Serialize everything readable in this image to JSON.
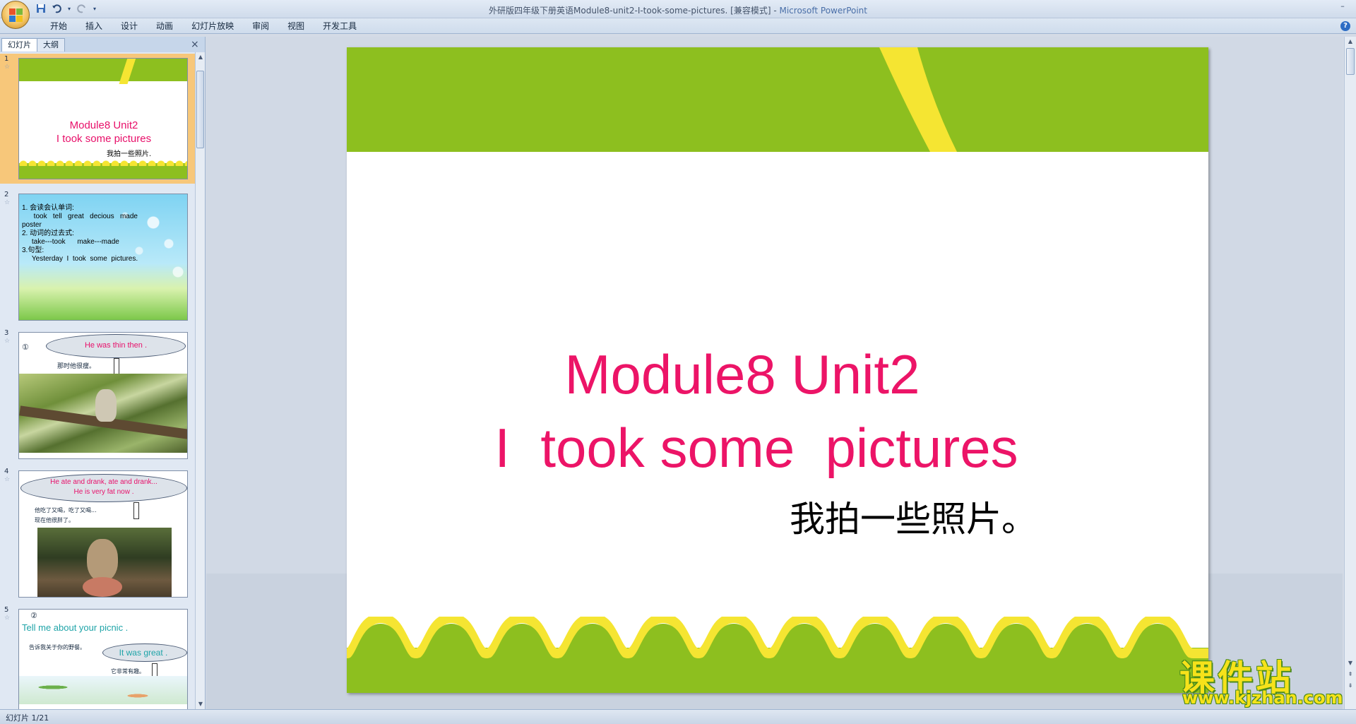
{
  "titlebar": {
    "document": "外研版四年级下册英语Module8-unit2-I-took-some-pictures. [兼容模式]",
    "separator": " - ",
    "app": "Microsoft PowerPoint"
  },
  "qat": {
    "save_icon": "save-icon",
    "undo_icon": "undo-icon",
    "redo_icon": "redo-icon",
    "customize_icon": "chevron-down-icon"
  },
  "ribbon": {
    "tabs": [
      "开始",
      "插入",
      "设计",
      "动画",
      "幻灯片放映",
      "审阅",
      "视图",
      "开发工具"
    ],
    "help": "?"
  },
  "left_pane": {
    "tabs": [
      "幻灯片",
      "大纲"
    ],
    "close": "×",
    "slides": [
      {
        "num": "1",
        "line1": "Module8 Unit2",
        "line2": "I  took some  pictures",
        "line3": "我拍一些照片."
      },
      {
        "num": "2",
        "text": "1. 会读会认单词:\n      took   tell   great   decious   made\nposter\n2. 动词的过去式:\n     take---took      make---made\n3.句型:\n     Yesterday  I  took  some  pictures."
      },
      {
        "num": "3",
        "circle": "①",
        "bubble": "He  was   thin  then .",
        "cn": "那时他很瘦。"
      },
      {
        "num": "4",
        "l1": "He ate  and  drank, ate and drank...",
        "l2": "He is  very  fat  now .",
        "cn1": "他吃了又喝，吃了又喝...",
        "cn2": "现在他很胖了。"
      },
      {
        "num": "5",
        "circle": "②",
        "title": "Tell me about your picnic .",
        "cn": "告诉我关于你的野餐。",
        "bubble": "It  was great .",
        "cn2": "它非常有趣。"
      }
    ]
  },
  "slide": {
    "line1": "Module8 Unit2",
    "line2": "I  took some  pictures",
    "line3": "我拍一些照片。"
  },
  "watermark": {
    "cn": "课件站",
    "url": "www.kjzhan.com"
  },
  "statusbar": {
    "slide_info": "幻灯片 1/21"
  },
  "colors": {
    "slide_green": "#8dbf1f",
    "slide_yellow": "#f5e532",
    "title_pink": "#ec1467"
  }
}
